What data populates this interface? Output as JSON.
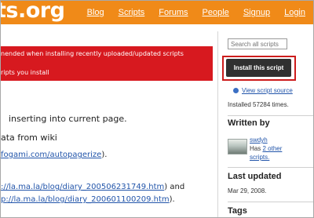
{
  "header": {
    "logo": "ts.org",
    "nav": [
      "Blog",
      "Scripts",
      "Forums",
      "People",
      "Signup",
      "Login"
    ]
  },
  "banner": {
    "line1": "nended when installing recently uploaded/updated scripts",
    "line2": "ripts you install"
  },
  "main": {
    "line1": "inserting into current page.",
    "line2": "ata from wiki",
    "line3_link": "fogami.com/autopagerize",
    "line3_tail": ").",
    "link4": "://la.ma.la/blog/diary_200506231749.htm",
    "link4_tail": ") and",
    "link5": "p://la.ma.la/blog/diary_200601100209.htm",
    "link5_tail": ")."
  },
  "sidebar": {
    "search_placeholder": "Search all scripts",
    "install_label": "Install this script",
    "view_source_label": "View script source",
    "installed_text": "Installed 57284 times.",
    "written_by_title": "Written by",
    "author": "swdyh",
    "has_label": "Has",
    "other_scripts_link": "2 other",
    "scripts_word": "scripts.",
    "last_updated_title": "Last updated",
    "last_updated_date": "Mar 29, 2008.",
    "tags_title": "Tags"
  },
  "colors": {
    "header_orange": "#f08a18",
    "banner_red": "#d7191f",
    "highlight_outline": "#cc1b1b",
    "install_button": "#303030",
    "link_blue": "#2255aa"
  }
}
